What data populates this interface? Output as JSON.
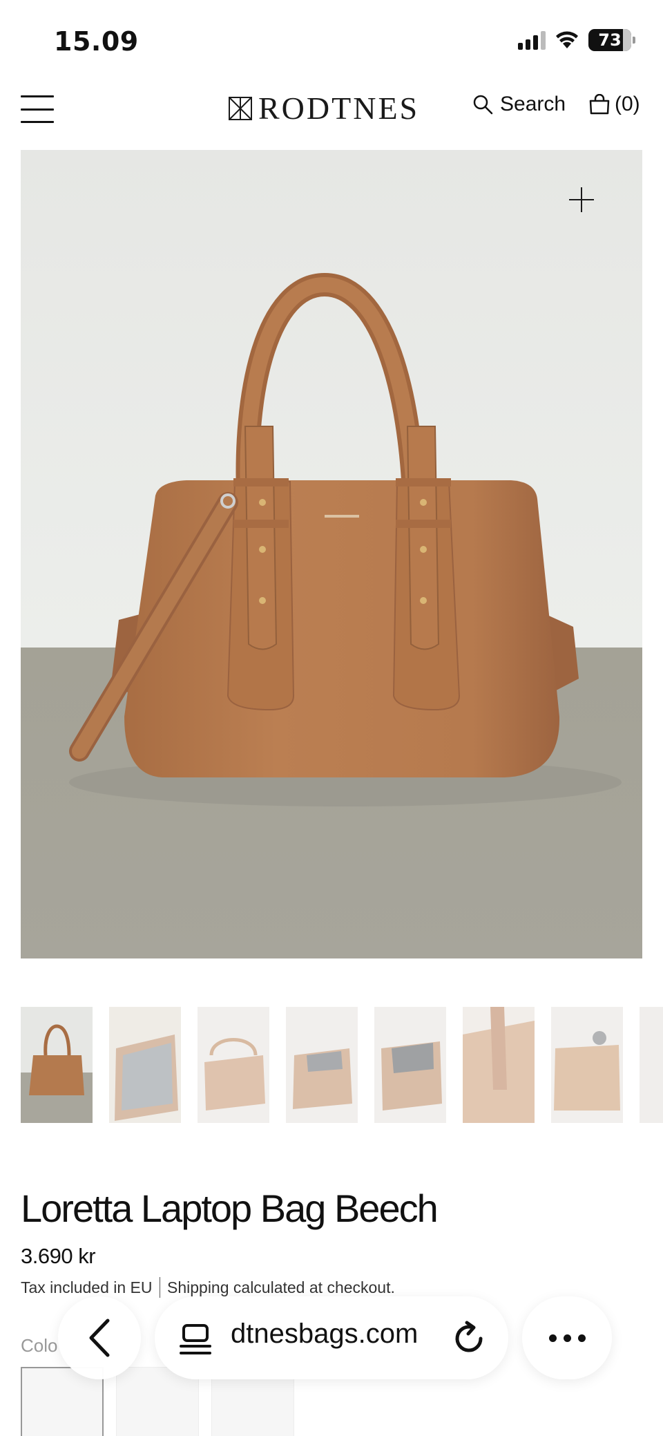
{
  "status_bar": {
    "time": "15.09",
    "battery": "73",
    "icons": [
      "signal-icon",
      "wifi-icon",
      "battery-icon"
    ]
  },
  "header": {
    "brand": "RODTNES",
    "search_label": "Search",
    "cart_count": "(0)",
    "icons": [
      "menu-icon",
      "logo-icon",
      "search-icon",
      "bag-icon"
    ]
  },
  "gallery": {
    "zoom_icon": "plus-icon",
    "thumbnail_count": 8
  },
  "product": {
    "title": "Loretta Laptop Bag Beech",
    "price": "3.690 kr",
    "tax_note": "Tax included in EU",
    "shipping_note": "Shipping calculated at checkout.",
    "color_label": "Colo"
  },
  "browser": {
    "url_text": "dtnesbags.com",
    "icons": [
      "back-icon",
      "tabs-icon",
      "reload-icon",
      "more-icon"
    ]
  },
  "colors": {
    "leather": "#b47a4e",
    "leather_dark": "#8f5a36",
    "wall": "#e8e9e6",
    "floor": "#a9a79d"
  }
}
